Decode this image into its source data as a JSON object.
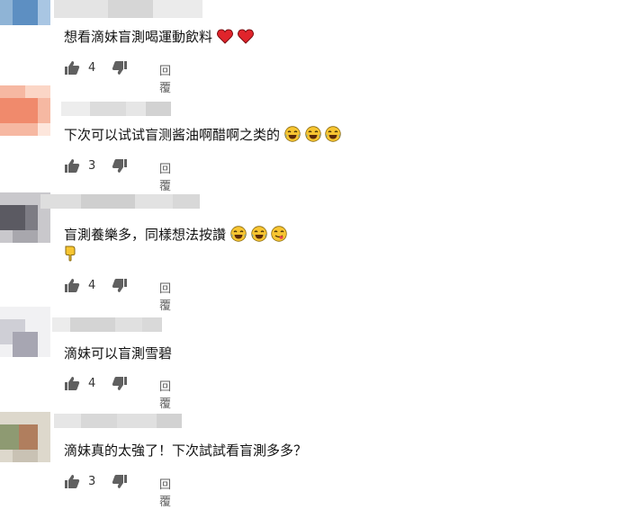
{
  "comments": [
    {
      "text": "想看滴妹盲測喝運動飲料",
      "emojis": [
        "heart-icon",
        "heart-icon"
      ],
      "likes": "4",
      "reply_label": "回覆"
    },
    {
      "text": "下次可以试试盲测酱油啊醋啊之类的",
      "emojis": [
        "laughing-tears-icon",
        "laughing-tears-icon",
        "laughing-tears-icon"
      ],
      "likes": "3",
      "reply_label": "回覆"
    },
    {
      "text": "盲測養樂多，同樣想法按讚",
      "emojis": [
        "laughing-tears-icon",
        "laughing-tears-icon",
        "yummy-face-icon",
        "point-down-icon"
      ],
      "likes": "4",
      "reply_label": "回覆"
    },
    {
      "text": "滴妹可以盲測雪碧",
      "emojis": [],
      "likes": "4",
      "reply_label": "回覆"
    },
    {
      "text": "滴妹真的太強了！下次試試看盲測多多？",
      "emojis": [],
      "likes": "3",
      "reply_label": "回覆"
    }
  ],
  "colors": {
    "heart": "#e0242b",
    "emoji_face": "#f7c531",
    "icon": "#606060",
    "text": "#111111"
  }
}
